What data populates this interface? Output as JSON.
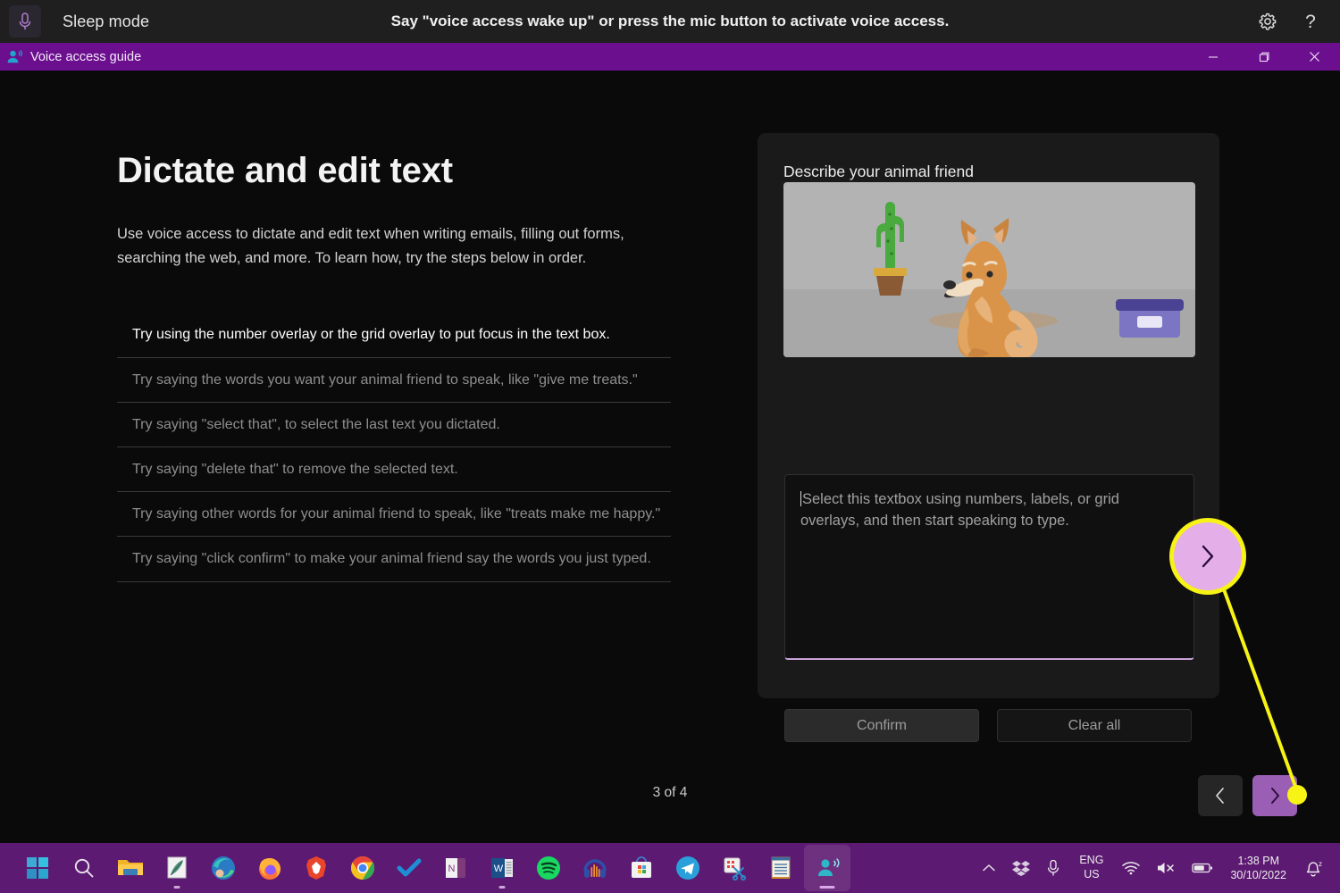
{
  "voice_access_bar": {
    "mic_icon": "microphone-icon",
    "mode_label": "Sleep mode",
    "hint": "Say \"voice access wake up\" or press the mic button to activate voice access.",
    "settings_icon": "gear-icon",
    "help_icon": "question-mark-icon"
  },
  "window": {
    "title": "Voice access guide",
    "app_icon": "voice-access-person-icon",
    "minimize_label": "Minimize",
    "maximize_label": "Maximize",
    "close_label": "Close",
    "titlebar_color": "#6b0f8f"
  },
  "guide": {
    "heading": "Dictate and edit text",
    "description": "Use voice access to dictate and edit text when writing emails, filling out forms, searching the web, and more. To learn how, try the steps below in order.",
    "steps": [
      {
        "text": "Try using the number overlay or the grid overlay to put focus in the text box.",
        "active": true
      },
      {
        "text": "Try saying the words you want your animal friend to speak, like \"give me treats.\"",
        "active": false
      },
      {
        "text": "Try saying \"select that\", to select the last text you dictated.",
        "active": false
      },
      {
        "text": "Try saying \"delete that\" to remove the selected text.",
        "active": false
      },
      {
        "text": "Try saying other words for your animal friend to speak, like \"treats make me happy.\"",
        "active": false
      },
      {
        "text": "Try saying \"click confirm\" to make your animal friend say the words you just typed.",
        "active": false
      }
    ],
    "pager": "3 of 4",
    "prev_icon": "chevron-left-icon",
    "next_icon": "chevron-right-icon"
  },
  "panel": {
    "title": "Describe your animal friend",
    "illustration": {
      "name": "dog-scene-illustration",
      "elements": [
        "cactus-in-pot",
        "shiba-dog",
        "purple-box"
      ],
      "background_color": "#b3b3b3",
      "ground_color": "#a8a8a8"
    },
    "textbox_placeholder": "Select this textbox using numbers, labels, or grid overlays, and then start speaking to type.",
    "textbox_value": "",
    "confirm_label": "Confirm",
    "clear_label": "Clear all",
    "accent_underline": "#c8a2d8"
  },
  "callout": {
    "target_icon": "chevron-right-icon",
    "highlight_color": "#f7f315",
    "lens_fill": "#e4aee8"
  },
  "taskbar": {
    "background": "#5d1a72",
    "apps": [
      {
        "name": "start-button",
        "label": "Start"
      },
      {
        "name": "search-icon",
        "label": "Search"
      },
      {
        "name": "file-explorer-icon",
        "label": "File Explorer"
      },
      {
        "name": "notepad-classic-icon",
        "label": "Notepad"
      },
      {
        "name": "microsoft-edge-icon",
        "label": "Microsoft Edge"
      },
      {
        "name": "firefox-icon",
        "label": "Firefox"
      },
      {
        "name": "brave-browser-icon",
        "label": "Brave"
      },
      {
        "name": "google-chrome-icon",
        "label": "Google Chrome"
      },
      {
        "name": "todo-checkmark-icon",
        "label": "Microsoft To Do"
      },
      {
        "name": "onenote-icon",
        "label": "OneNote"
      },
      {
        "name": "word-icon",
        "label": "Word"
      },
      {
        "name": "spotify-icon",
        "label": "Spotify"
      },
      {
        "name": "audacity-icon",
        "label": "Audacity"
      },
      {
        "name": "microsoft-store-icon",
        "label": "Microsoft Store"
      },
      {
        "name": "telegram-icon",
        "label": "Telegram"
      },
      {
        "name": "snipping-tool-icon",
        "label": "Snipping Tool"
      },
      {
        "name": "notepad-icon",
        "label": "Notepad"
      },
      {
        "name": "voice-access-icon",
        "label": "Voice access"
      }
    ],
    "tray": {
      "chevron_up_icon": "show-hidden-icons",
      "dropbox_icon": "dropbox-icon",
      "mic_icon": "microphone-icon",
      "language_line1": "ENG",
      "language_line2": "US",
      "wifi_icon": "wifi-icon",
      "volume_icon": "volume-muted-icon",
      "battery_icon": "battery-icon",
      "time": "1:38 PM",
      "date": "30/10/2022",
      "notification_icon": "notifications-silent-icon"
    }
  }
}
